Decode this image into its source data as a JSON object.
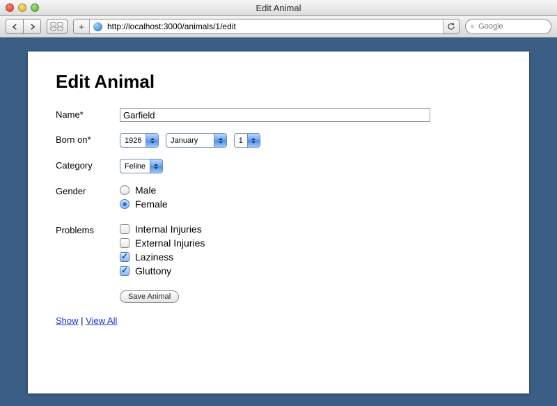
{
  "window": {
    "title": "Edit Animal"
  },
  "browser": {
    "url": "http://localhost:3000/animals/1/edit",
    "search_placeholder": "Google"
  },
  "page": {
    "heading": "Edit Animal",
    "labels": {
      "name": "Name*",
      "born_on": "Born on*",
      "category": "Category",
      "gender": "Gender",
      "problems": "Problems"
    },
    "name_value": "Garfield",
    "born_on": {
      "year": "1926",
      "month": "January",
      "day": "1"
    },
    "category_value": "Feline",
    "gender": {
      "options": {
        "male": "Male",
        "female": "Female"
      },
      "selected": "female"
    },
    "problems": {
      "internal": {
        "label": "Internal Injuries",
        "checked": false
      },
      "external": {
        "label": "External Injuries",
        "checked": false
      },
      "laziness": {
        "label": "Laziness",
        "checked": true
      },
      "gluttony": {
        "label": "Gluttony",
        "checked": true
      }
    },
    "submit_label": "Save Animal",
    "links": {
      "show": "Show",
      "view_all": "View All",
      "sep": " | "
    }
  }
}
